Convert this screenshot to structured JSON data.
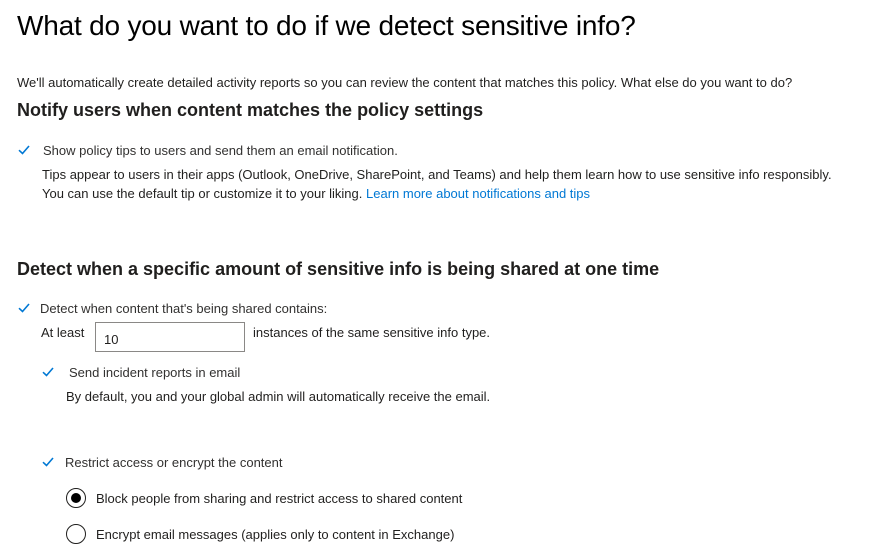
{
  "page": {
    "title": "What do you want to do if we detect sensitive info?",
    "intro": "We'll automatically create detailed activity reports so you can review the content that matches this policy. What else do you want to do?"
  },
  "notify": {
    "heading": "Notify users when content matches the policy settings",
    "show_tips": {
      "checked": true,
      "label": "Show policy tips to users and send them an email notification."
    },
    "desc1": "Tips appear to users in their apps (Outlook, OneDrive, SharePoint, and Teams) and help them learn how to use sensitive info responsibly.",
    "desc2": "You can use the default tip or customize it to your liking.",
    "learn_more": "Learn more about notifications and tips"
  },
  "detect": {
    "heading": "Detect when a specific amount of sensitive info is being shared at one time",
    "detect_content": {
      "checked": true,
      "label": "Detect when content that's being shared contains:"
    },
    "at_least_label": "At least",
    "instances_value": "10",
    "instances_suffix": "instances of the same sensitive info type.",
    "incident_reports": {
      "checked": true,
      "label": "Send incident reports in email"
    },
    "incident_desc": "By default, you and your global admin will automatically receive the email.",
    "restrict": {
      "checked": true,
      "label": "Restrict access or encrypt the content"
    },
    "options": [
      {
        "label": "Block people from sharing and restrict access to shared content",
        "selected": true
      },
      {
        "label": "Encrypt email messages (applies only to content in Exchange)",
        "selected": false
      }
    ]
  },
  "colors": {
    "accent": "#0078d4",
    "text": "#201f1e"
  },
  "icons": {
    "checkbox": "checkmark-icon",
    "radio": "radio-icon"
  }
}
